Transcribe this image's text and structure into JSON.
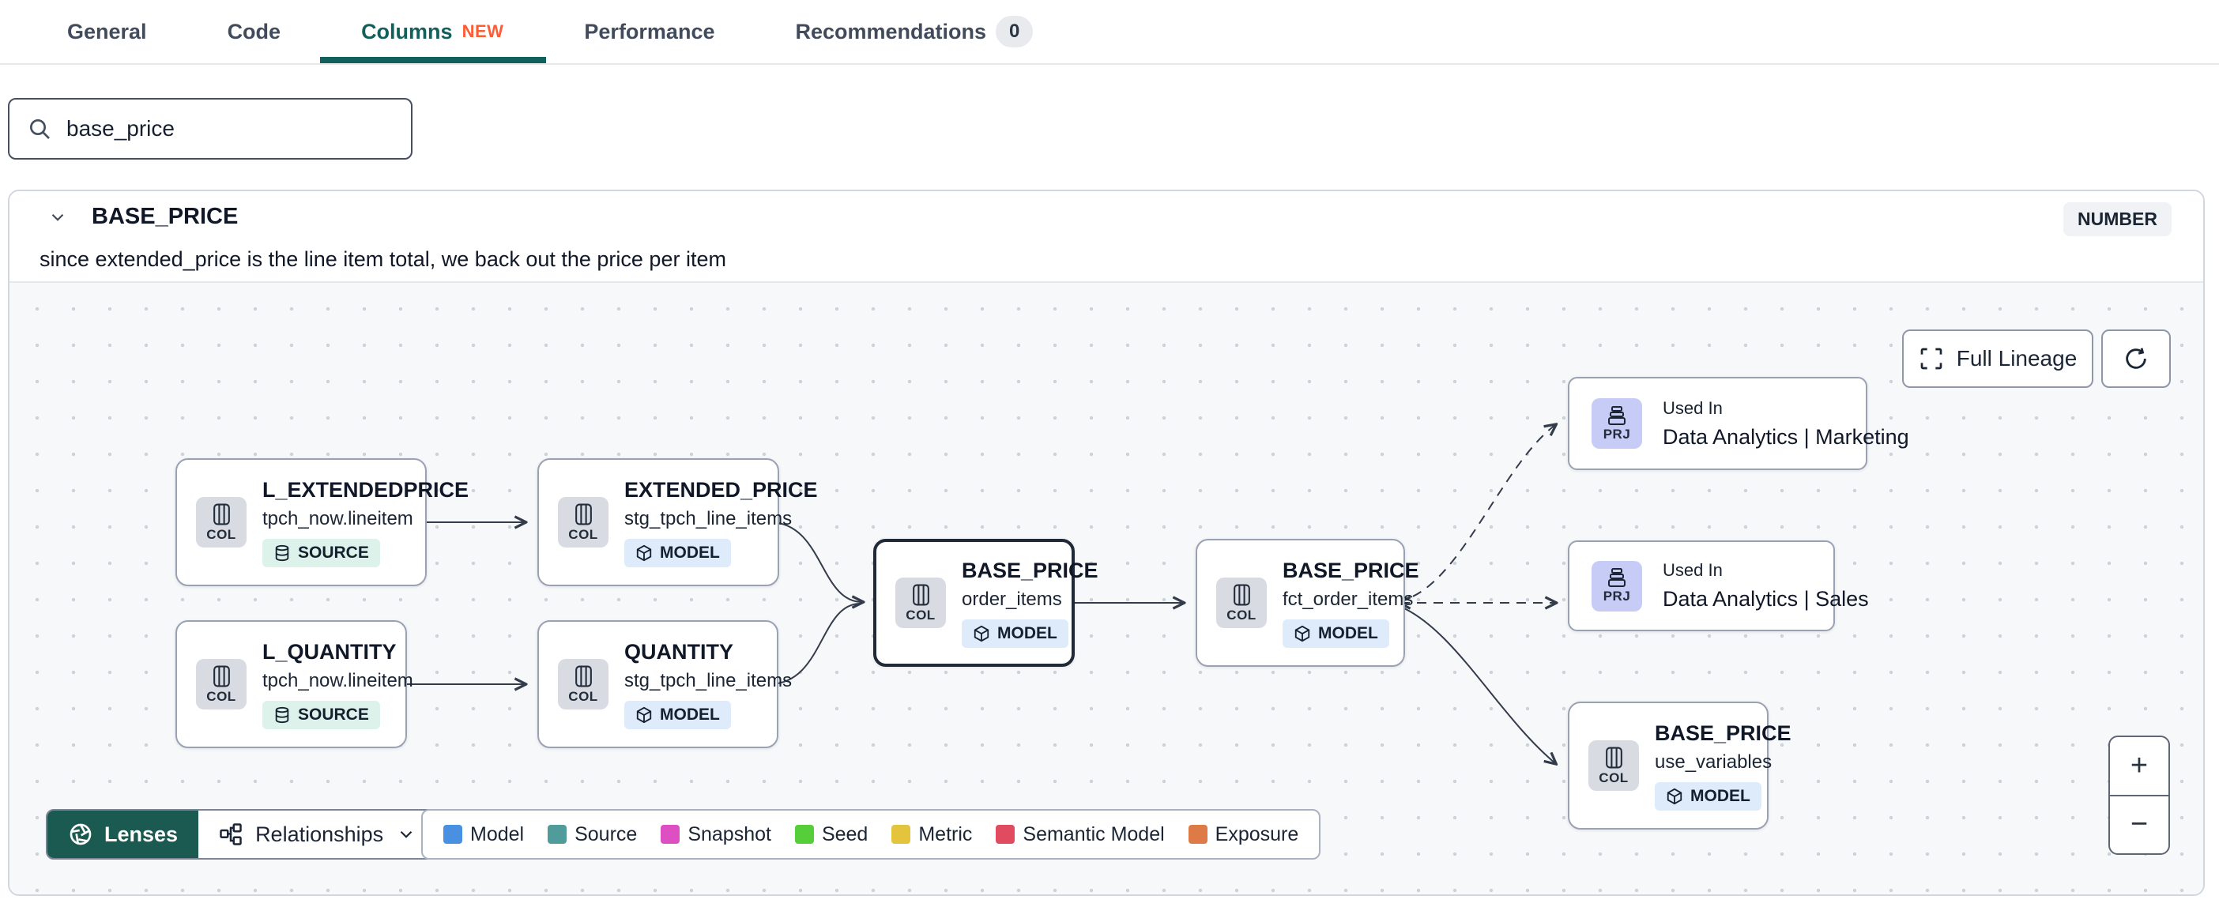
{
  "tabs": {
    "items": [
      {
        "label": "General"
      },
      {
        "label": "Code"
      },
      {
        "label": "Columns",
        "badge": "NEW"
      },
      {
        "label": "Performance"
      },
      {
        "label": "Recommendations",
        "count": "0"
      }
    ]
  },
  "search": {
    "value": "base_price"
  },
  "column": {
    "name": "BASE_PRICE",
    "type": "NUMBER",
    "description": "since extended_price is the line item total, we back out the price per item"
  },
  "lineage": {
    "full_lineage_label": "Full Lineage",
    "zoom_in": "+",
    "zoom_out": "−",
    "lenses_label": "Lenses",
    "relationships_label": "Relationships",
    "legend": [
      {
        "label": "Model",
        "color": "#4A90E2"
      },
      {
        "label": "Source",
        "color": "#4F9C9A"
      },
      {
        "label": "Snapshot",
        "color": "#DD4FC2"
      },
      {
        "label": "Seed",
        "color": "#55CE3A"
      },
      {
        "label": "Metric",
        "color": "#E4C43D"
      },
      {
        "label": "Semantic Model",
        "color": "#E14B5F"
      },
      {
        "label": "Exposure",
        "color": "#DE7A45"
      }
    ],
    "nodes": [
      {
        "icon_label": "COL",
        "title": "L_EXTENDEDPRICE",
        "subtitle": "tpch_now.lineitem",
        "badge": "SOURCE"
      },
      {
        "icon_label": "COL",
        "title": "EXTENDED_PRICE",
        "subtitle": "stg_tpch_line_items",
        "badge": "MODEL"
      },
      {
        "icon_label": "COL",
        "title": "L_QUANTITY",
        "subtitle": "tpch_now.lineitem",
        "badge": "SOURCE"
      },
      {
        "icon_label": "COL",
        "title": "QUANTITY",
        "subtitle": "stg_tpch_line_items",
        "badge": "MODEL"
      },
      {
        "icon_label": "COL",
        "title": "BASE_PRICE",
        "subtitle": "order_items",
        "badge": "MODEL"
      },
      {
        "icon_label": "COL",
        "title": "BASE_PRICE",
        "subtitle": "fct_order_items",
        "badge": "MODEL"
      },
      {
        "icon_label": "PRJ",
        "kicker": "Used In",
        "title": "Data Analytics | Marketing"
      },
      {
        "icon_label": "PRJ",
        "kicker": "Used In",
        "title": "Data Analytics | Sales"
      },
      {
        "icon_label": "COL",
        "title": "BASE_PRICE",
        "subtitle": "use_variables",
        "badge": "MODEL"
      }
    ]
  }
}
